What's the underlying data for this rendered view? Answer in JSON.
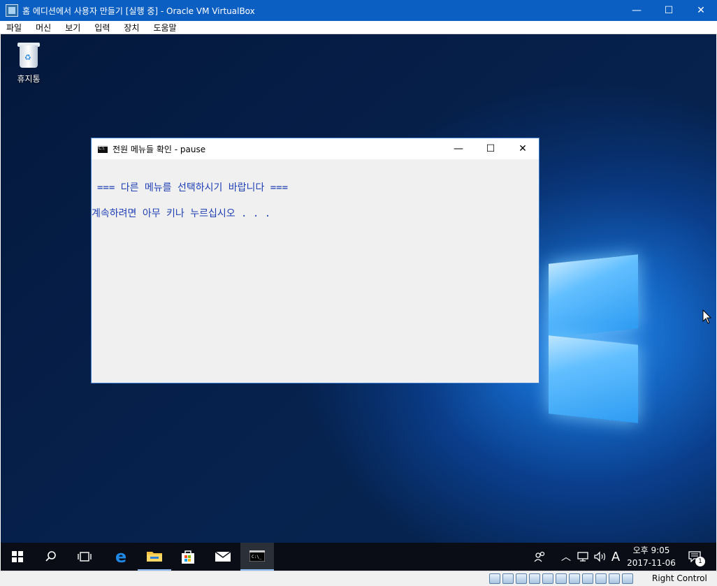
{
  "host": {
    "title": "홈 에디션에서 사용자 만들기 [실행 중] - Oracle VM VirtualBox",
    "menu": [
      "파일",
      "머신",
      "보기",
      "입력",
      "장치",
      "도움말"
    ],
    "status_icons": [
      "hard-disk-icon",
      "optical-drive-icon",
      "audio-icon",
      "network-icon",
      "usb-icon",
      "shared-folders-icon",
      "display-icon",
      "video-capture-icon",
      "cpu-icon",
      "mouse-integration-icon",
      "host-key-icon"
    ],
    "host_key": "Right Control"
  },
  "desktop": {
    "recycle_bin_label": "휴지통"
  },
  "console": {
    "title": "전원 메뉴들 확인 - pause",
    "line1": "=== 다른 메뉴를 선택하시기 바랍니다 ===",
    "line2": "계속하려면 아무 키나 누르십시오 . . ."
  },
  "taskbar": {
    "pinned": [
      "start",
      "search",
      "task-view",
      "edge",
      "file-explorer",
      "store",
      "mail",
      "cmd"
    ],
    "input_indicator": "A",
    "clock_time": "오후 9:05",
    "clock_date": "2017-11-06",
    "notification_count": "1"
  },
  "colors": {
    "host_title_bg": "#0b5fc2",
    "console_text": "#1f3fb5",
    "console_bg": "#f0f0f0",
    "taskbar_bg": "#0a0d16"
  }
}
